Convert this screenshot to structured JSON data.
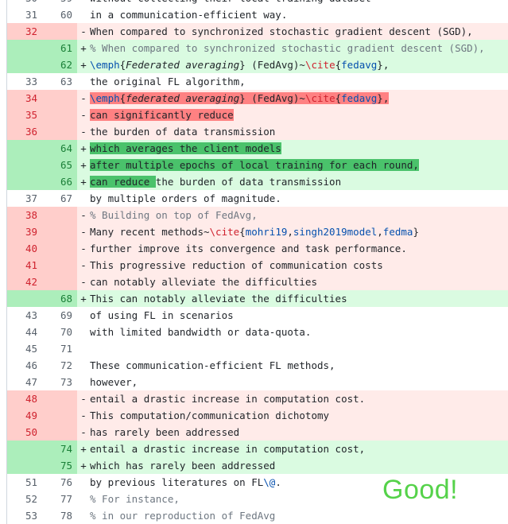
{
  "diff": {
    "lines": [
      {
        "type": "ctx",
        "old": "30",
        "new": "59",
        "text": "without collecting their local training dataset"
      },
      {
        "type": "ctx",
        "old": "31",
        "new": "60",
        "text": "in a communication-efficient way."
      },
      {
        "type": "del",
        "old": "32",
        "new": "",
        "text": "When compared to synchronized stochastic gradient descent (SGD),"
      },
      {
        "type": "add",
        "old": "",
        "new": "61",
        "text": "% When compared to synchronized stochastic gradient descent (SGD),"
      },
      {
        "type": "add",
        "old": "",
        "new": "62",
        "text": "\\emph{Federated averaging} (FedAvg)~\\cite{fedavg},"
      },
      {
        "type": "ctx",
        "old": "33",
        "new": "63",
        "text": "the original FL algorithm,"
      },
      {
        "type": "del",
        "old": "34",
        "new": "",
        "text": "\\emph{federated averaging} (FedAvg)~\\cite{fedavg},",
        "hl": true
      },
      {
        "type": "del",
        "old": "35",
        "new": "",
        "text": "can significantly reduce",
        "hl": true
      },
      {
        "type": "del",
        "old": "36",
        "new": "",
        "text": "the burden of data transmission"
      },
      {
        "type": "add",
        "old": "",
        "new": "64",
        "text": "which averages the client models",
        "hl": true
      },
      {
        "type": "add",
        "old": "",
        "new": "65",
        "text": "after multiple epochs of local training for each round,",
        "hl": true
      },
      {
        "type": "add",
        "old": "",
        "new": "66",
        "text": "can reduce the burden of data transmission",
        "hlpart": "can reduce "
      },
      {
        "type": "ctx",
        "old": "37",
        "new": "67",
        "text": "by multiple orders of magnitude."
      },
      {
        "type": "del",
        "old": "38",
        "new": "",
        "text": "% Building on top of FedAvg,"
      },
      {
        "type": "del",
        "old": "39",
        "new": "",
        "text": "Many recent methods~\\cite{mohri19,singh2019model,fedma}"
      },
      {
        "type": "del",
        "old": "40",
        "new": "",
        "text": "further improve its convergence and task performance."
      },
      {
        "type": "del",
        "old": "41",
        "new": "",
        "text": "This progressive reduction of communication costs"
      },
      {
        "type": "del",
        "old": "42",
        "new": "",
        "text": "can notably alleviate the difficulties"
      },
      {
        "type": "add",
        "old": "",
        "new": "68",
        "text": "This can notably alleviate the difficulties"
      },
      {
        "type": "ctx",
        "old": "43",
        "new": "69",
        "text": "of using FL in scenarios"
      },
      {
        "type": "ctx",
        "old": "44",
        "new": "70",
        "text": "with limited bandwidth or data-quota."
      },
      {
        "type": "ctx",
        "old": "45",
        "new": "71",
        "text": ""
      },
      {
        "type": "ctx",
        "old": "46",
        "new": "72",
        "text": "These communication-efficient FL methods,"
      },
      {
        "type": "ctx",
        "old": "47",
        "new": "73",
        "text": "however,"
      },
      {
        "type": "del",
        "old": "48",
        "new": "",
        "text": "entail a drastic increase in computation cost."
      },
      {
        "type": "del",
        "old": "49",
        "new": "",
        "text": "This computation/communication dichotomy"
      },
      {
        "type": "del",
        "old": "50",
        "new": "",
        "text": "has rarely been addressed"
      },
      {
        "type": "add",
        "old": "",
        "new": "74",
        "text": "entail a drastic increase in computation cost,"
      },
      {
        "type": "add",
        "old": "",
        "new": "75",
        "text": "which has rarely been addressed"
      },
      {
        "type": "ctx",
        "old": "51",
        "new": "76",
        "text": "by previous literatures on FL\\@."
      },
      {
        "type": "ctx",
        "old": "52",
        "new": "77",
        "text": "% For instance,"
      },
      {
        "type": "ctx",
        "old": "53",
        "new": "78",
        "text": "% in our reproduction of FedAvg"
      }
    ]
  },
  "annotation": {
    "text": "Good!"
  },
  "colors": {
    "keyword": "#cf222e",
    "argument": "#0550ae",
    "comment": "#6e7781",
    "good": "#55d24a"
  }
}
